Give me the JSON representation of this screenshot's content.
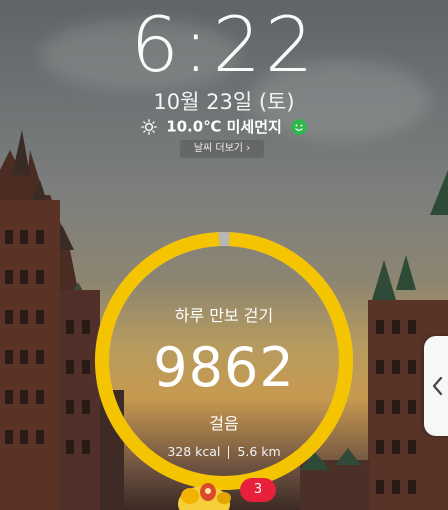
{
  "lockscreen": {
    "time": "6:22",
    "date": "10월 23일 (토)",
    "weather": {
      "icon": "sun-icon",
      "temperature": "10.0℃",
      "air_label": "미세먼지",
      "air_icon": "smile-face-icon",
      "air_color": "#2fb64c",
      "more_button": "날씨 더보기"
    }
  },
  "pedometer": {
    "title": "하루 만보 걷기",
    "steps": "9862",
    "unit": "걸음",
    "calories": "328 kcal",
    "distance": "5.6 km",
    "goal_progress": 0.986,
    "ring_color": "#f5c400"
  },
  "notification_badge": {
    "count": "3",
    "color": "#e8203c"
  },
  "edge_panel": {
    "icon": "chevron-left-icon"
  }
}
